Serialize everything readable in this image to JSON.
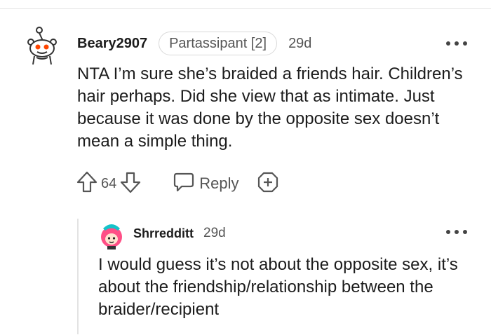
{
  "comment": {
    "username": "Beary2907",
    "flair": "Partassipant [2]",
    "age": "29d",
    "body": "NTA I’m sure she’s braided a friends hair. Children’s hair perhaps. Did she view that as intimate. Just because it was done by the opposite sex doesn’t mean a simple thing.",
    "score": "64",
    "reply_label": "Reply"
  },
  "reply": {
    "username": "Shrredditt",
    "age": "29d",
    "body": "I would guess it’s not about the opposite sex, it’s about the friendship/relationship between the braider/recipient"
  },
  "icons": [
    "snoo-avatar-icon",
    "upvote-icon",
    "downvote-icon",
    "reply-icon",
    "award-icon",
    "more-options-icon",
    "user-avatar-icon"
  ]
}
